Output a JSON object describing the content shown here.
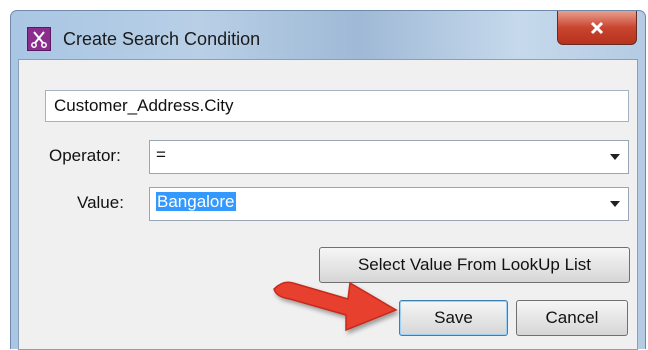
{
  "window": {
    "title": "Create Search Condition",
    "close_label": "X"
  },
  "form": {
    "field_path": "Customer_Address.City",
    "operator_label": "Operator:",
    "operator_value": "=",
    "value_label": "Value:",
    "value_value": "Bangalore"
  },
  "buttons": {
    "lookup_label": "Select Value From LookUp List",
    "save_label": "Save",
    "cancel_label": "Cancel"
  },
  "icons": {
    "app": "scissors-icon",
    "close": "close-icon",
    "dropdown": "chevron-down-icon",
    "annotation": "red-arrow-annotation"
  },
  "colors": {
    "selection": "#3399ff",
    "annotation_arrow": "#e8402f"
  }
}
